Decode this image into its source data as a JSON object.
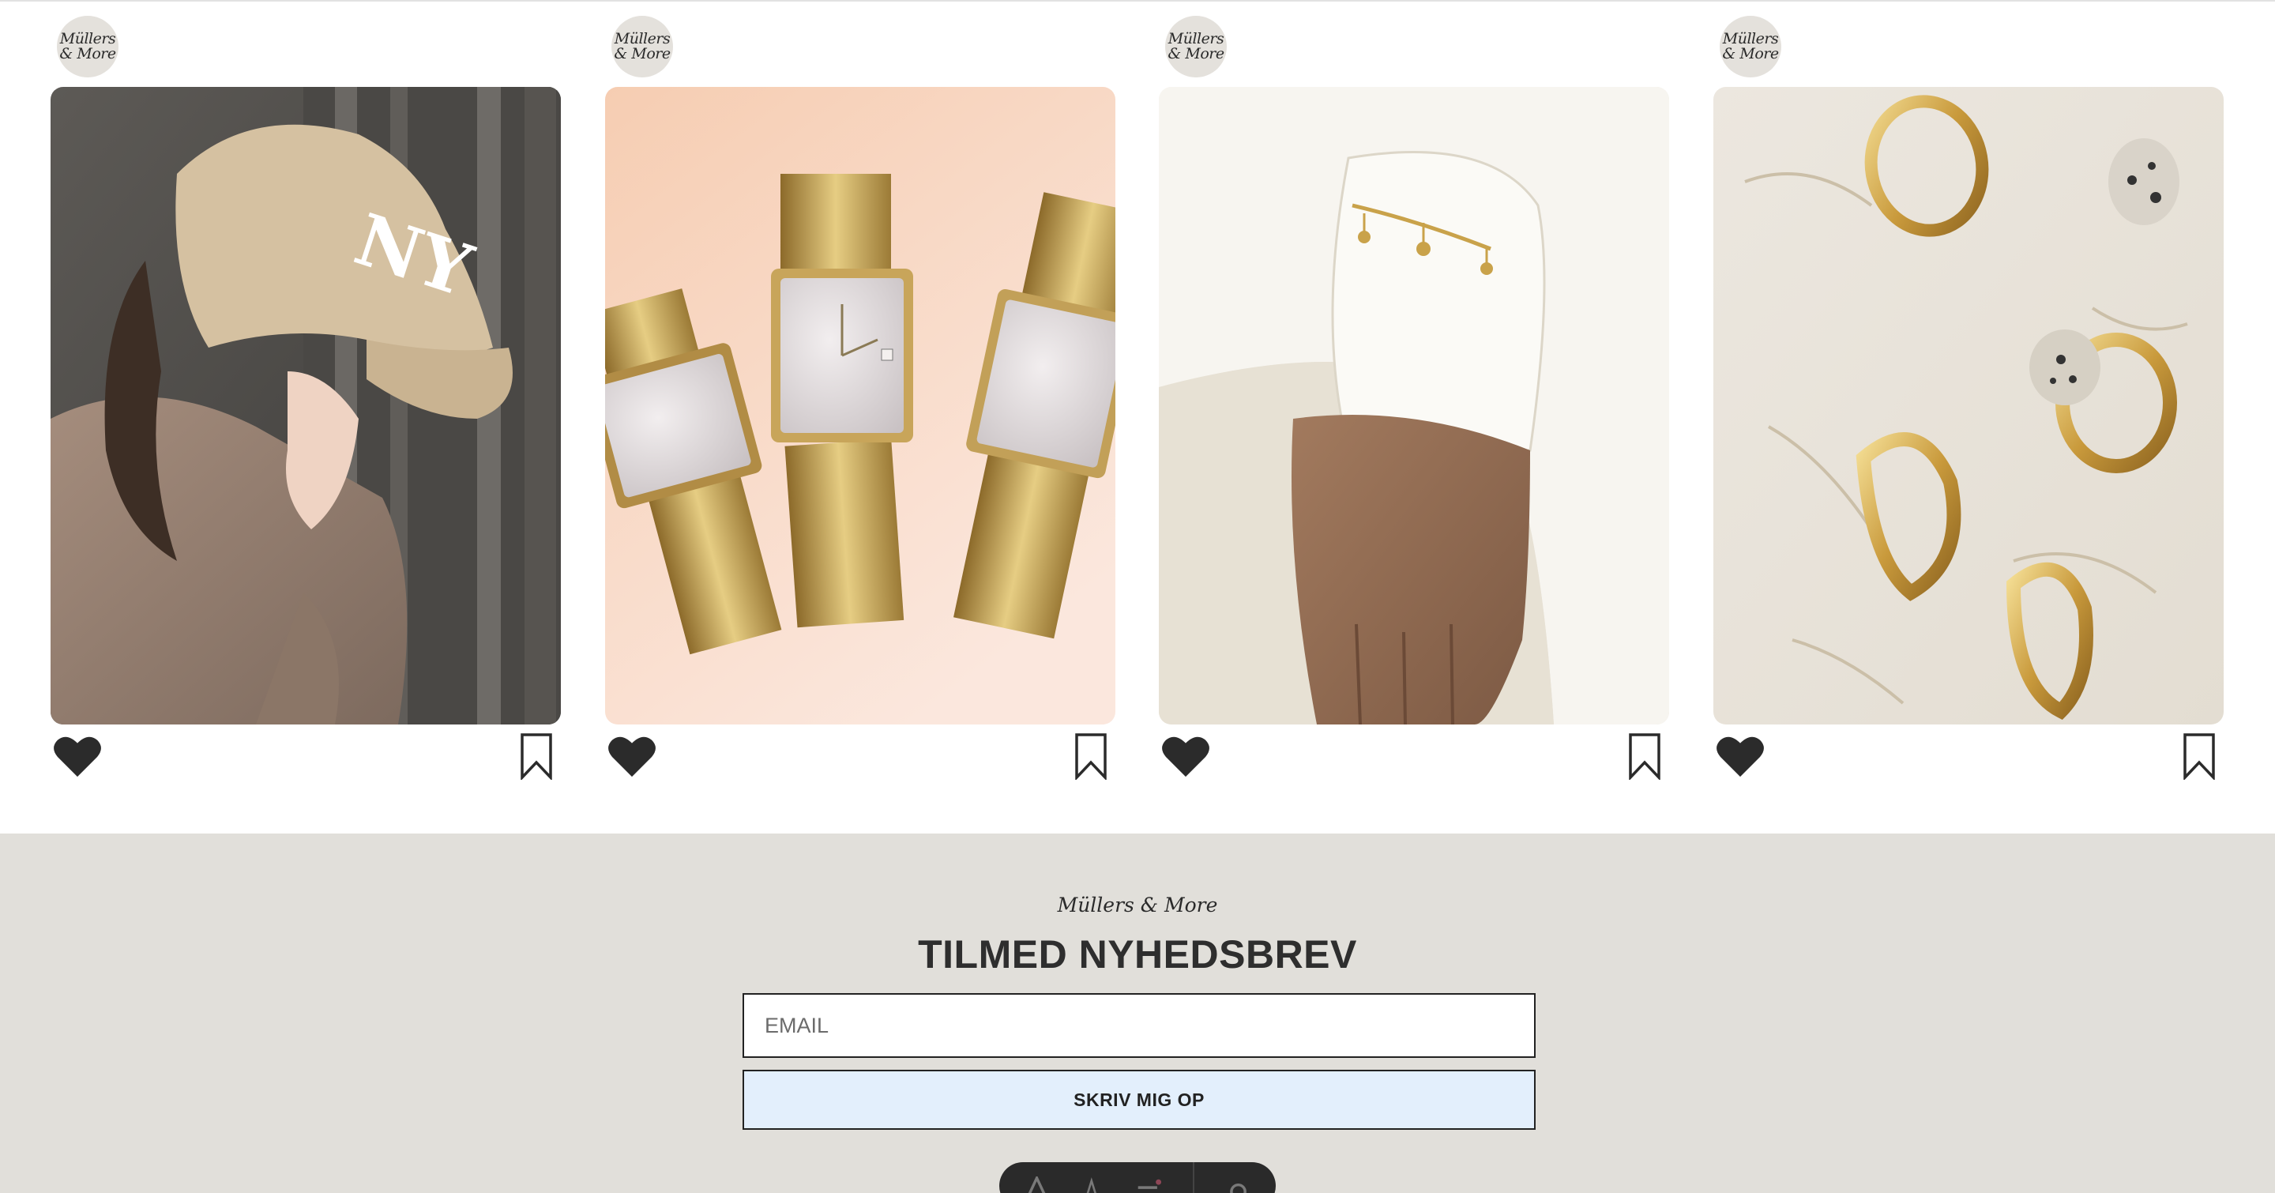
{
  "brand": {
    "avatar_line1": "Müllers",
    "avatar_line2": "& More",
    "wordmark": "Müllers & More"
  },
  "feed": {
    "posts": [
      {
        "image": "woman-in-beige-cap-photo"
      },
      {
        "image": "gold-square-watches-photo"
      },
      {
        "image": "gold-charm-bracelet-wrist-photo"
      },
      {
        "image": "gold-hoop-earrings-in-plaster-photo"
      }
    ],
    "icons": {
      "like": "heart-icon",
      "save": "bookmark-icon"
    }
  },
  "newsletter": {
    "title": "TILMED NYHEDSBREV",
    "email_placeholder": "EMAIL",
    "email_value": "",
    "submit_label": "SKRIV MIG OP"
  },
  "colors": {
    "newsletter_bg": "#e1dfda",
    "button_bg": "#e3effc",
    "avatar_bg": "#e4e1dc",
    "icon": "#2b2b2b"
  }
}
